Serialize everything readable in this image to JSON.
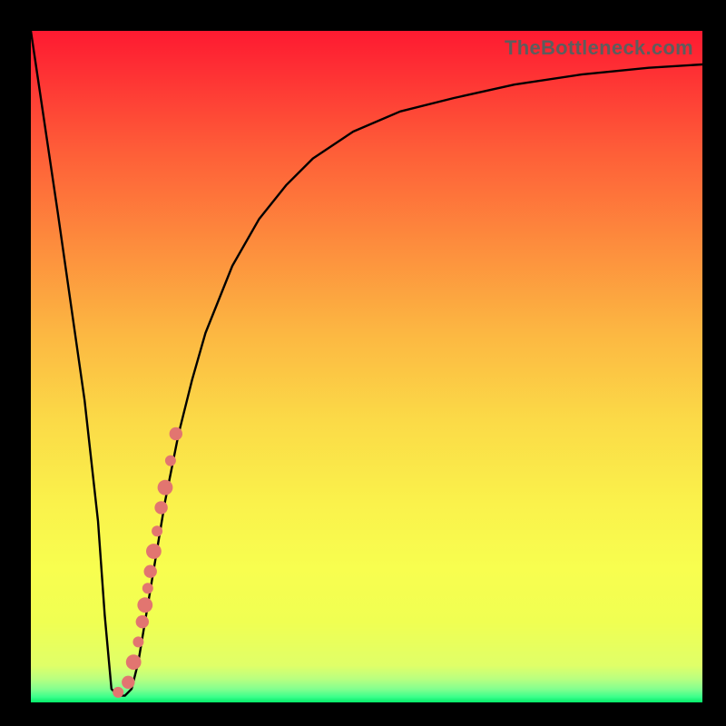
{
  "watermark": "TheBottleneck.com",
  "colors": {
    "curve": "#000000",
    "points": "#e27570",
    "bg_top": "#fe1a31",
    "bg_bottom": "#05eb69",
    "frame": "#000000"
  },
  "chart_data": {
    "type": "line",
    "title": "",
    "xlabel": "",
    "ylabel": "",
    "xlim": [
      0,
      100
    ],
    "ylim": [
      0,
      100
    ],
    "grid": false,
    "legend": false,
    "x": [
      0,
      4,
      8,
      10,
      11,
      12,
      13,
      14,
      15,
      16,
      18,
      20,
      22,
      24,
      26,
      28,
      30,
      34,
      38,
      42,
      48,
      55,
      63,
      72,
      82,
      92,
      100
    ],
    "y": [
      100,
      73,
      45,
      27,
      13,
      2,
      1,
      1,
      2,
      6,
      18,
      30,
      40,
      48,
      55,
      60,
      65,
      72,
      77,
      81,
      85,
      88,
      90,
      92,
      93.5,
      94.5,
      95
    ],
    "series": [
      {
        "name": "highlight-points",
        "type": "scatter",
        "x": [
          13.0,
          14.5,
          15.3,
          16.0,
          16.6,
          17.0,
          17.4,
          17.8,
          18.3,
          18.8,
          19.4,
          20.0,
          20.8,
          21.6
        ],
        "y": [
          1.5,
          3.0,
          6.0,
          9.0,
          12.0,
          14.5,
          17.0,
          19.5,
          22.5,
          25.5,
          29.0,
          32.0,
          36.0,
          40.0
        ]
      }
    ]
  }
}
